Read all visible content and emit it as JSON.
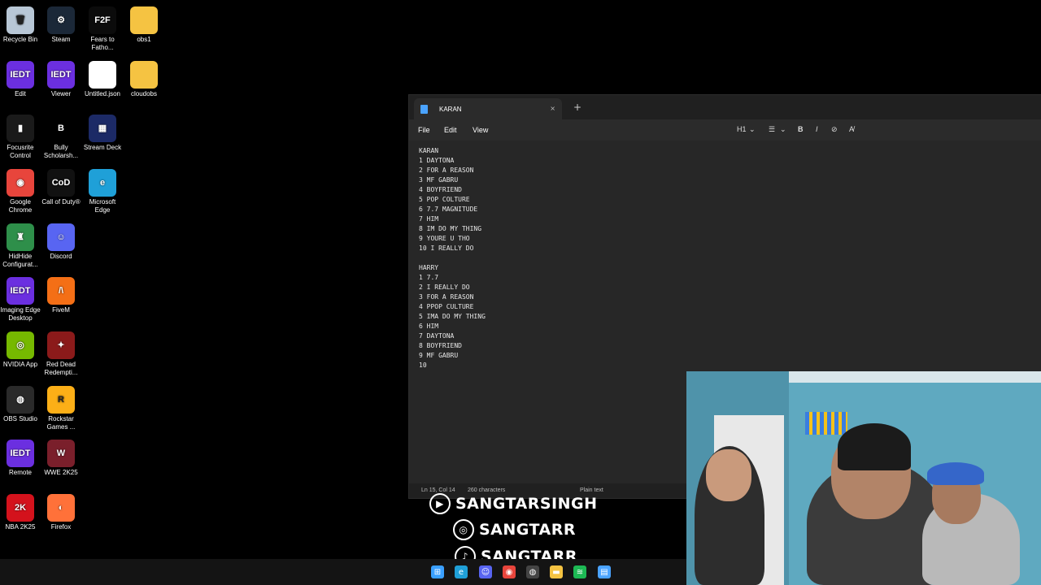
{
  "desktop": {
    "icons": [
      {
        "label": "Recycle Bin",
        "glyph": "🗑",
        "color": "#b8c7d6"
      },
      {
        "label": "Steam",
        "glyph": "⚙",
        "color": "#1b2838"
      },
      {
        "label": "Fears to Fatho...",
        "glyph": "F2F",
        "color": "#0b0b0b"
      },
      {
        "label": "obs1",
        "glyph": "",
        "color": "#f5c342"
      },
      {
        "label": "Edit",
        "glyph": "IEDT",
        "color": "#6b2fe0"
      },
      {
        "label": "Viewer",
        "glyph": "IEDT",
        "color": "#6b2fe0"
      },
      {
        "label": "Untitled.json",
        "glyph": "",
        "color": "#ffffff"
      },
      {
        "label": "cloudobs",
        "glyph": "",
        "color": "#f5c342"
      },
      {
        "label": "Focusrite Control",
        "glyph": "▮",
        "color": "#1a1a1a"
      },
      {
        "label": "Bully Scholarsh...",
        "glyph": "B",
        "color": "#000000"
      },
      {
        "label": "Stream Deck",
        "glyph": "▦",
        "color": "#1c2a66"
      },
      {
        "label": "Google Chrome",
        "glyph": "◉",
        "color": "#e8453c"
      },
      {
        "label": "Call of Duty®",
        "glyph": "CoD",
        "color": "#111111"
      },
      {
        "label": "Microsoft Edge",
        "glyph": "e",
        "color": "#1fa0d8"
      },
      {
        "label": "HidHide Configurat...",
        "glyph": "♜",
        "color": "#2e8f4a"
      },
      {
        "label": "Discord",
        "glyph": "☺",
        "color": "#5865f2"
      },
      {
        "label": "Imaging Edge Desktop",
        "glyph": "IEDT",
        "color": "#6b2fe0"
      },
      {
        "label": "FiveM",
        "glyph": "/\\",
        "color": "#f46f16"
      },
      {
        "label": "NVIDIA App",
        "glyph": "◎",
        "color": "#76b900"
      },
      {
        "label": "Red Dead Redempti...",
        "glyph": "✦",
        "color": "#8b1a1a"
      },
      {
        "label": "OBS Studio",
        "glyph": "◍",
        "color": "#2a2a2a"
      },
      {
        "label": "Rockstar Games ...",
        "glyph": "R",
        "color": "#fcaf17"
      },
      {
        "label": "Remote",
        "glyph": "IEDT",
        "color": "#6b2fe0"
      },
      {
        "label": "WWE 2K25",
        "glyph": "W",
        "color": "#7a1f2b"
      },
      {
        "label": "NBA 2K25",
        "glyph": "2K",
        "color": "#d4121c"
      },
      {
        "label": "Firefox",
        "glyph": "◐",
        "color": "#ff7139"
      }
    ]
  },
  "notepad": {
    "tab_title": "KARAN",
    "tab_close": "×",
    "new_tab": "+",
    "menu": {
      "file": "File",
      "edit": "Edit",
      "view": "View"
    },
    "format": {
      "heading": "H1",
      "list": "☰",
      "bold": "B",
      "italic": "I",
      "link": "⊘",
      "clear": "A̸"
    },
    "lines": [
      "KARAN",
      "1 DAYTONA",
      "2 FOR A REASON",
      "3 MF GABRU",
      "4 BOYFRIEND",
      "5 POP COLTURE",
      "6 7.7 MAGNITUDE",
      "7 HIM",
      "8 IM DO MY THING",
      "9 YOURE U THO",
      "10 I REALLY DO",
      "",
      "HARRY",
      "1 7.7",
      "2 I REALLY DO",
      "3 FOR A REASON",
      "4 PPOP CULTURE",
      "5 IMA DO MY THING",
      "6 HIM",
      "7 DAYTONA",
      "8 BOYFRIEND",
      "9 MF GABRU",
      "10"
    ],
    "status": {
      "position": "Ln 15, Col 14",
      "chars": "260 characters",
      "mode": "Plain text"
    }
  },
  "socials": [
    {
      "icon": "▶",
      "handle": "SANGTARSINGH"
    },
    {
      "icon": "◎",
      "handle": "SANGTARR"
    },
    {
      "icon": "♪",
      "handle": "SANGTARR"
    }
  ],
  "taskbar": {
    "icons": [
      {
        "name": "windows-start",
        "glyph": "⊞",
        "color": "#3aa0ff"
      },
      {
        "name": "edge",
        "glyph": "e",
        "color": "#1fa0d8"
      },
      {
        "name": "discord",
        "glyph": "☺",
        "color": "#5865f2"
      },
      {
        "name": "chrome",
        "glyph": "◉",
        "color": "#e8453c"
      },
      {
        "name": "obs",
        "glyph": "◍",
        "color": "#444444"
      },
      {
        "name": "file-explorer",
        "glyph": "▬",
        "color": "#f5c342"
      },
      {
        "name": "spotify",
        "glyph": "≋",
        "color": "#1db954"
      },
      {
        "name": "notepad",
        "glyph": "▤",
        "color": "#4aa3ff"
      }
    ]
  }
}
